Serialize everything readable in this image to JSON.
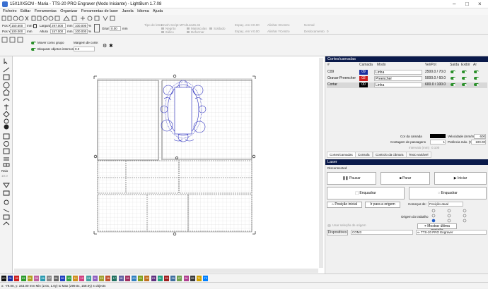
{
  "title": "15X10X5CM - Maria - TTS-20 PRO Engraver (Modo Iniciante) - LightBurn 1.7.08",
  "menu": [
    "Ficheiro",
    "Editar",
    "Ferramentas",
    "Organizar",
    "Ferramentas de laser",
    "Janela",
    "Idioma",
    "Ajuda"
  ],
  "toolbar": {
    "xpos_label": "Pos X",
    "xpos": "150.500",
    "ypos_label": "Pos Y",
    "ypos": "100.000",
    "unit_mm": "mm",
    "width_label": "Largura",
    "width": "297.000",
    "height_label": "Altura",
    "height": "157.000",
    "pct_w": "100.000",
    "pct_h": "100.000",
    "pct": "%",
    "rotate_label": "Girar",
    "rotate": "0.00",
    "font_label": "Tipo de letra",
    "font": "Brush Script MT",
    "altura_label": "Altura",
    "altura": "26.34",
    "bold": "Negrito",
    "italic": "Itálico",
    "upper": "Maiúsculas",
    "distort": "Deformar",
    "welded": "Soldado",
    "hspace_label": "Espaç. em H",
    "hspace": "0.00",
    "vspace_label": "Espaç. em V",
    "vspace": "0.00",
    "alignx_label": "Alinhar X",
    "alignx": "Centro",
    "aligny_label": "Alinhar Y",
    "aligny": "Centro",
    "normal": "Normal",
    "offset_label": "Deslocamento",
    "offset": "0"
  },
  "toolbar2": {
    "move_group": "Mover como grupo",
    "lock_inner": "Bloquear objetos internos",
    "cut_margin_label": "Margem de corte:",
    "cut_margin": "0.0"
  },
  "left": {
    "radius_label": "Raio",
    "radius": "10.0"
  },
  "cuts": {
    "header": "Cortes/camadas",
    "cols": [
      "#",
      "Camada",
      "Modo",
      "Vel/Pot",
      "Saída",
      "Exibir",
      "Ar"
    ],
    "rows": [
      {
        "name": "C09",
        "layer": "09",
        "color": "#1a2fa0",
        "mode": "Linha",
        "speed": "2500.0 / 70.0"
      },
      {
        "name": "Gravar-Preencher",
        "layer": "02",
        "color": "#cc2020",
        "mode": "Preencher",
        "speed": "5000.0 / 60.0"
      },
      {
        "name": "Cortar",
        "layer": "00",
        "color": "#000000",
        "mode": "Linha",
        "speed": "600.0 / 100.0"
      }
    ],
    "layer_color_label": "Cor da camada",
    "speed_label": "Velocidade (mm/m)",
    "speed": "600",
    "passes_label": "Contagem de passagens",
    "passes": "1",
    "power_label": "Potência máx. (%)",
    "power": "100.00",
    "interval_label": "Intervalo (mm)",
    "interval": "0.100",
    "tabs": [
      "Cortes/camadas",
      "Consola",
      "Controlo da câmara",
      "Texto variável"
    ]
  },
  "laser": {
    "header": "Laser",
    "status": "Disconnected",
    "pause": "Pausar",
    "stop": "Parar",
    "start": "Iniciar",
    "frame1": "Enquadrar",
    "frame2": "Enquadrar",
    "home": "Posição inicial",
    "goto_origin": "Ir para a origem",
    "start_from_label": "Começar de:",
    "start_from": "Posição atual",
    "origin_label": "Origem do trabalho",
    "use_selection": "Usar seleção de origem",
    "show_last": "Mostrar última posição",
    "devices_label": "Dispositivos",
    "port": "COM3",
    "device": "TTS-20 PRO Engraver"
  },
  "palette": [
    {
      "label": "00",
      "color": "#111111"
    },
    {
      "label": "01",
      "color": "#1a2fa0"
    },
    {
      "label": "02",
      "color": "#cc2020"
    },
    {
      "label": "03",
      "color": "#2a9a2a"
    },
    {
      "label": "04",
      "color": "#b0a020"
    },
    {
      "label": "05",
      "color": "#c060a0"
    },
    {
      "label": "06",
      "color": "#2a9ab0"
    },
    {
      "label": "07",
      "color": "#888888"
    },
    {
      "label": "08",
      "color": "#666666"
    },
    {
      "label": "09",
      "color": "#2040c0"
    },
    {
      "label": "10",
      "color": "#30a040"
    },
    {
      "label": "11",
      "color": "#d09020"
    },
    {
      "label": "12",
      "color": "#d04080"
    },
    {
      "label": "13",
      "color": "#40a0a0"
    },
    {
      "label": "14",
      "color": "#9060c0"
    },
    {
      "label": "15",
      "color": "#a0a030"
    },
    {
      "label": "16",
      "color": "#c05030"
    },
    {
      "label": "17",
      "color": "#207060"
    },
    {
      "label": "18",
      "color": "#6060a0"
    },
    {
      "label": "19",
      "color": "#a03060"
    },
    {
      "label": "20",
      "color": "#3080c0"
    },
    {
      "label": "21",
      "color": "#80a020"
    },
    {
      "label": "22",
      "color": "#c07020"
    },
    {
      "label": "23",
      "color": "#603080"
    },
    {
      "label": "24",
      "color": "#20a080"
    },
    {
      "label": "25",
      "color": "#a02020"
    },
    {
      "label": "26",
      "color": "#4070a0"
    },
    {
      "label": "27",
      "color": "#70a050"
    },
    {
      "label": "28",
      "color": "#b04090"
    },
    {
      "label": "29",
      "color": "#3a3a3a"
    },
    {
      "label": "T1",
      "color": "#d0a000"
    },
    {
      "label": "T2",
      "color": "#0080ff"
    }
  ],
  "status": "x: -79.00, y: 343.00 mm   Min (2.0x, 1.0y) to Max (299.0x, 158.0y)  4 objects"
}
